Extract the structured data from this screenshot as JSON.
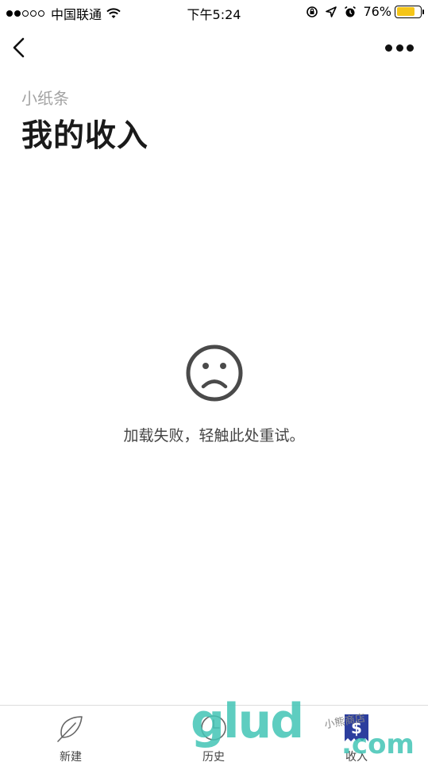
{
  "status_bar": {
    "carrier": "中国联通",
    "time": "下午5:24",
    "battery_percent": "76%",
    "battery_level": 0.76,
    "battery_color": "#f5c518",
    "signal_bars_filled": 2,
    "signal_bars_total": 5
  },
  "nav": {
    "back_icon": "chevron-left-icon",
    "more_icon": "more-dots-icon"
  },
  "header": {
    "subtitle": "小纸条",
    "title": "我的收入"
  },
  "error": {
    "icon": "sad-face-icon",
    "message": "加载失败，轻触此处重试。"
  },
  "tabs": [
    {
      "label": "新建",
      "icon": "leaf-icon",
      "active": false
    },
    {
      "label": "历史",
      "icon": "clock-icon",
      "active": false
    },
    {
      "label": "收入",
      "icon": "dollar-receipt-icon",
      "active": true
    }
  ],
  "watermark": {
    "main": "glud",
    "suffix": ".com",
    "small": "小熊商店"
  },
  "colors": {
    "active_tab": "#2c3e9e",
    "watermark": "#43c5b6"
  }
}
